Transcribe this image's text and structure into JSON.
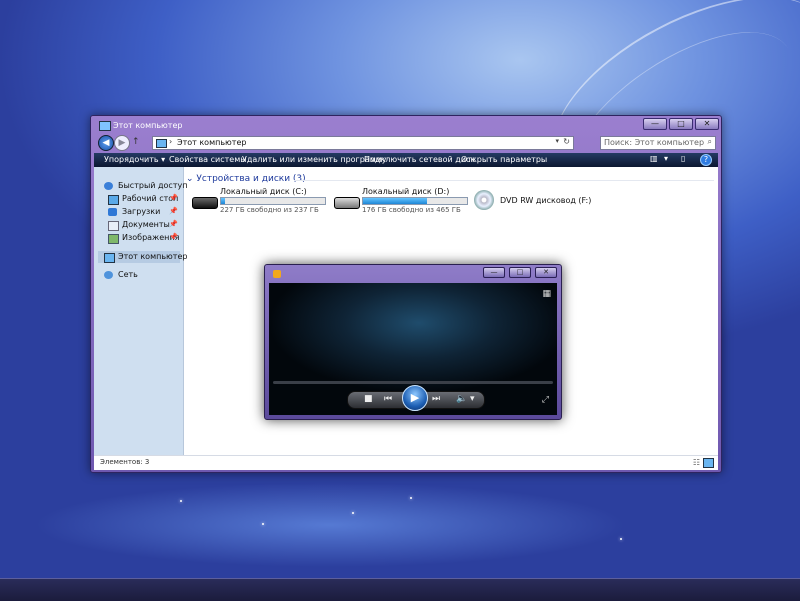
{
  "explorer": {
    "title": "Этот компьютер",
    "window_buttons": {
      "minimize": "—",
      "maximize": "□",
      "close": "✕"
    },
    "nav": {
      "back": "◀",
      "forward": "▶",
      "up": "↑",
      "separator": "›",
      "address": "Этот компьютер",
      "dropdown": "▾",
      "refresh": "↻"
    },
    "search": {
      "placeholder": "Поиск: Этот компьютер",
      "icon": "⌕"
    },
    "commands": [
      {
        "label": "Упорядочить ▾"
      },
      {
        "label": "Свойства системы"
      },
      {
        "label": "Удалить или изменить программу"
      },
      {
        "label": "Подключить сетевой диск"
      },
      {
        "label": "Открыть параметры"
      }
    ],
    "right_commands": {
      "view": "▥",
      "dropdown": "▾",
      "pane": "▯",
      "help": "?"
    },
    "sidebar": {
      "items": [
        {
          "label": "Быстрый доступ",
          "icon": "star-icon",
          "pinned": false
        },
        {
          "label": "Рабочий стол",
          "icon": "desktop-icon",
          "pinned": true
        },
        {
          "label": "Загрузки",
          "icon": "download-icon",
          "pinned": true
        },
        {
          "label": "Документы",
          "icon": "document-icon",
          "pinned": true
        },
        {
          "label": "Изображения",
          "icon": "pictures-icon",
          "pinned": true
        },
        {
          "label": "Этот компьютер",
          "icon": "computer-icon",
          "selected": true
        },
        {
          "label": "Сеть",
          "icon": "network-icon"
        }
      ],
      "pin_glyph": "📌"
    },
    "section_title": "Устройства и диски (3)",
    "section_chevron": "⌄",
    "drives": [
      {
        "name": "Локальный диск (C:)",
        "free": "227 ГБ свободно из 237 ГБ",
        "used_fraction": 0.04
      },
      {
        "name": "Локальный диск (D:)",
        "free": "176 ГБ свободно из 465 ГБ",
        "used_fraction": 0.62
      },
      {
        "name": "DVD RW дисковод (F:)"
      }
    ],
    "status": {
      "items_text": "Элементов: 3",
      "view_details": "☷"
    }
  },
  "player": {
    "window_buttons": {
      "minimize": "—",
      "maximize": "□",
      "close": "✕"
    },
    "controls": {
      "stop": "■",
      "prev": "⏮",
      "play": "▶",
      "next": "⏭",
      "volume": "🔈",
      "vol_dd": "▾",
      "view": "▦",
      "expand": "⤢"
    }
  },
  "colors": {
    "accent": "#1e86d6",
    "section_title": "#1e3a9c",
    "frame": "#7f66c0"
  }
}
